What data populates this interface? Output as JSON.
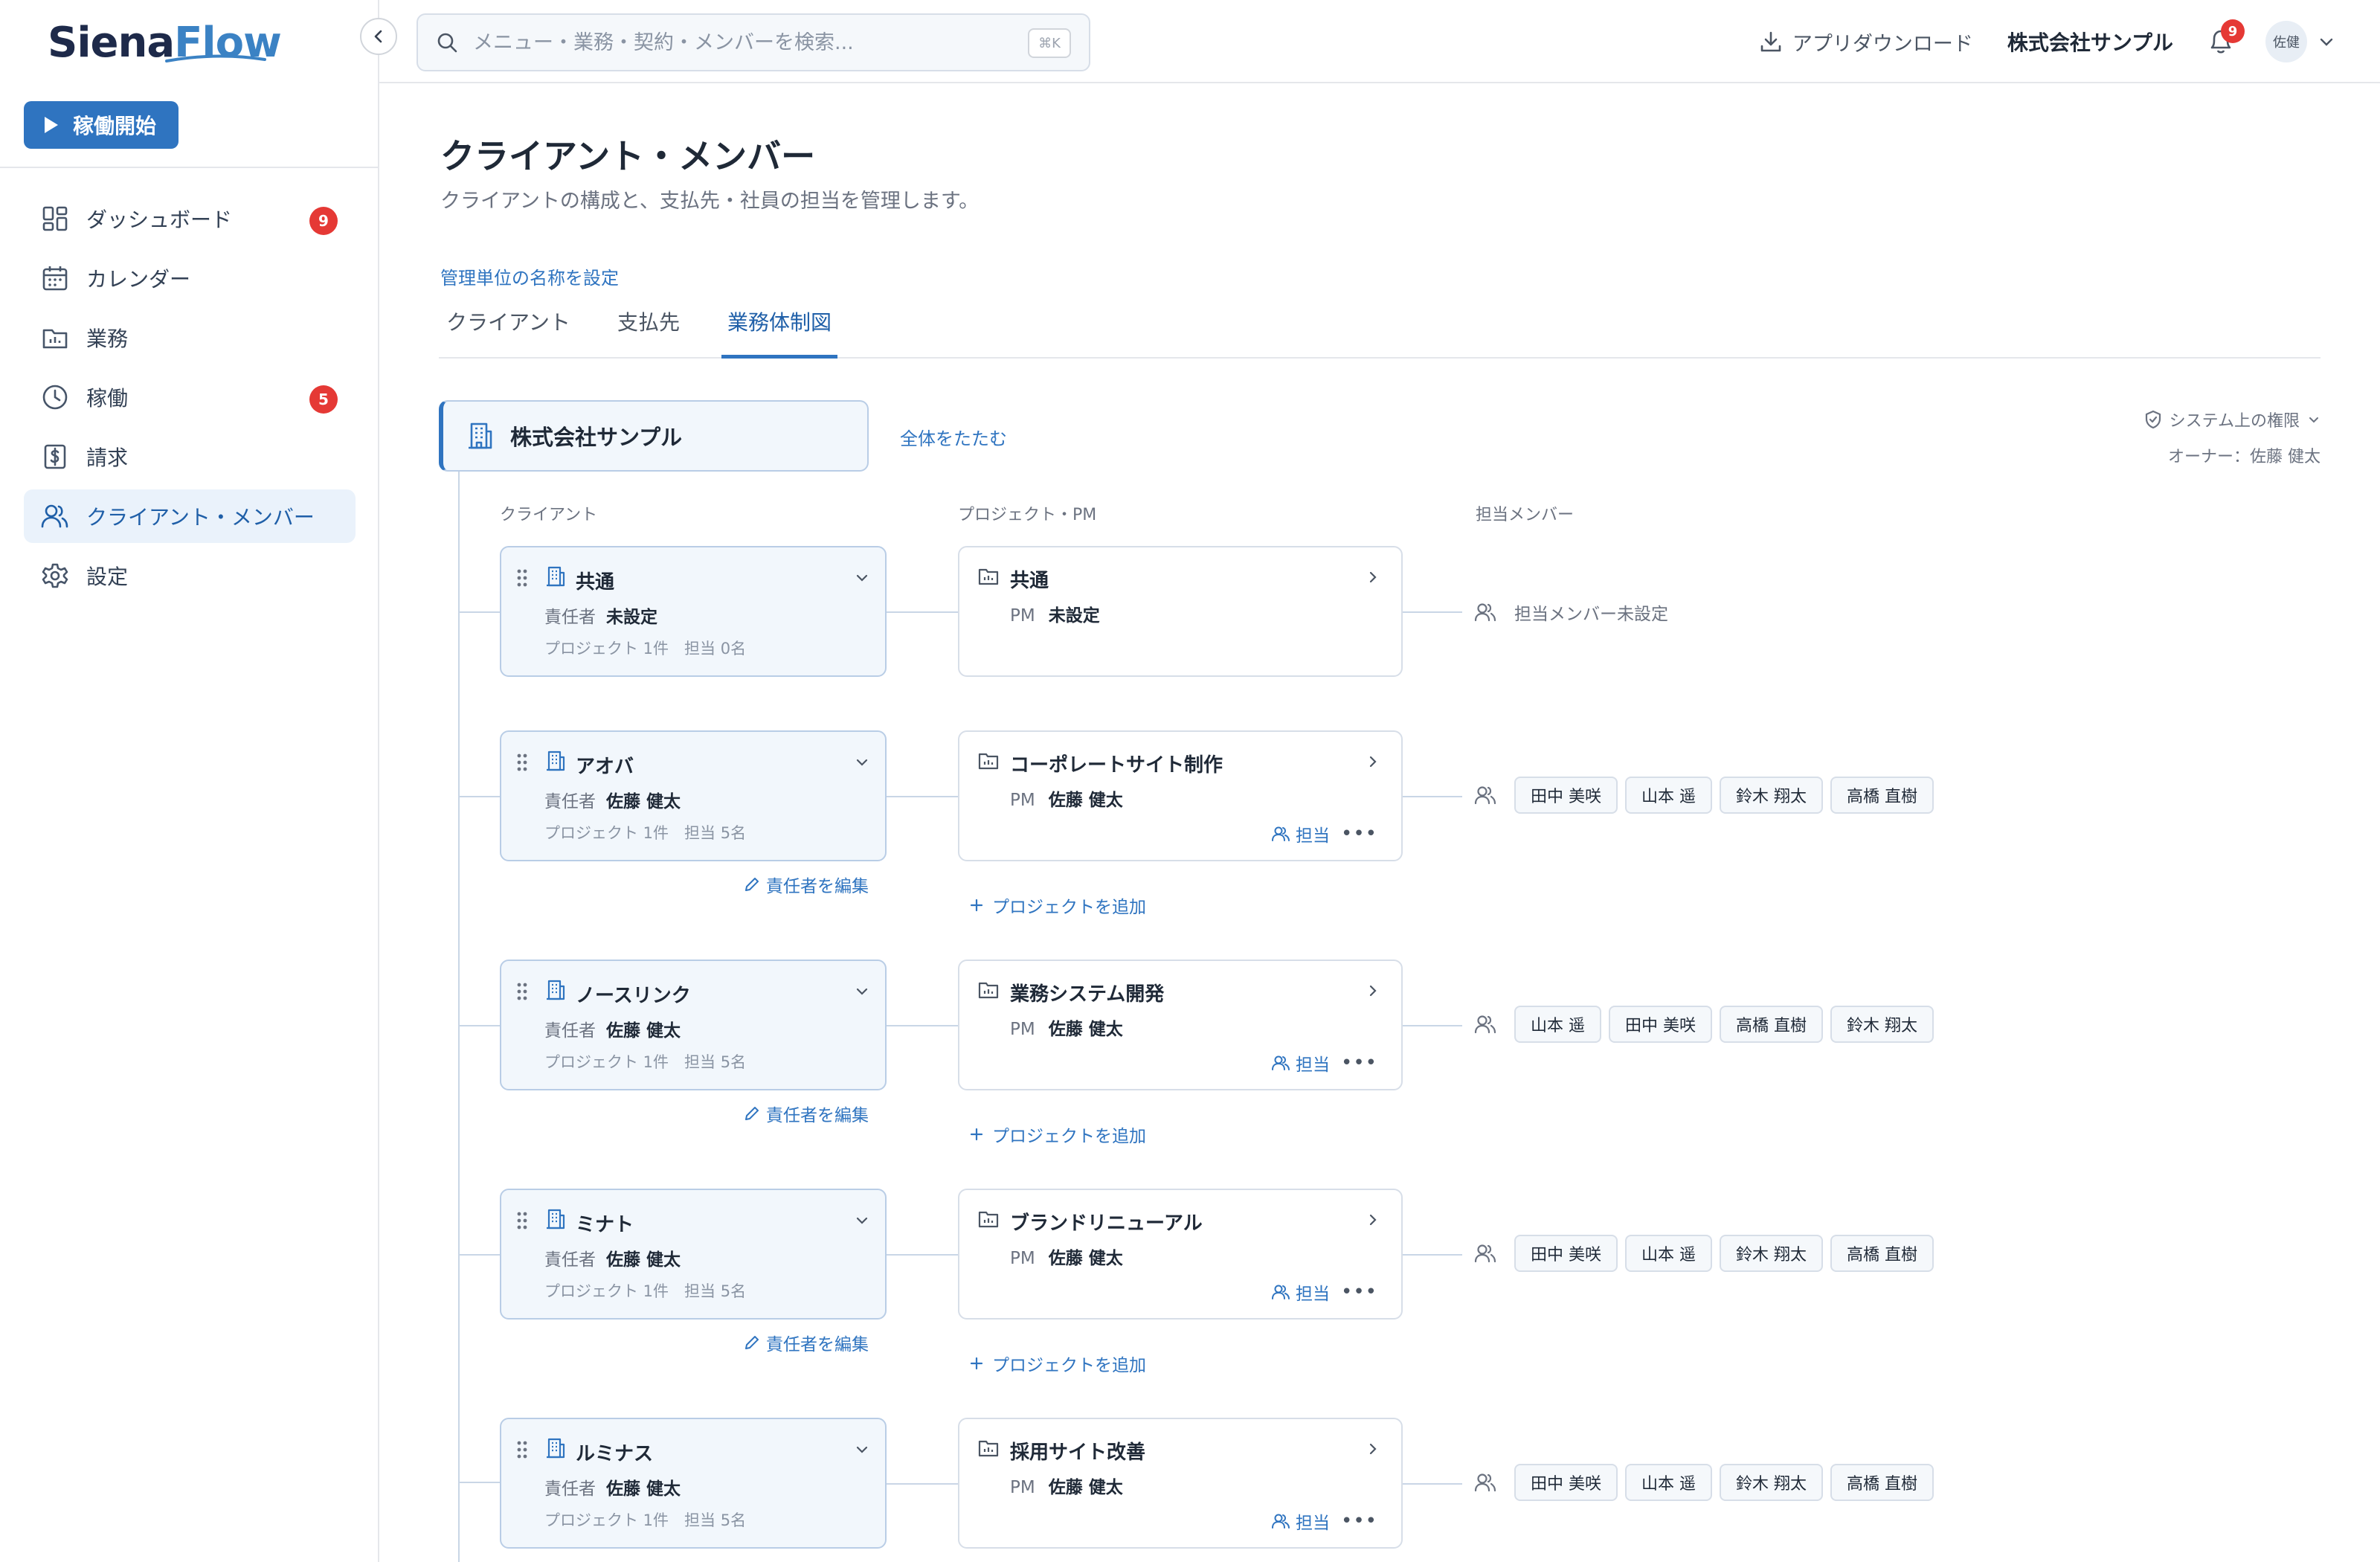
{
  "brand": {
    "logo_part1": "Siena",
    "logo_part2": "Flow"
  },
  "sidebar": {
    "start_button": "稼働開始",
    "items": [
      {
        "label": "ダッシュボード",
        "badge": "9",
        "icon": "dashboard-icon"
      },
      {
        "label": "カレンダー",
        "badge": "",
        "icon": "calendar-icon"
      },
      {
        "label": "業務",
        "badge": "",
        "icon": "folder-icon"
      },
      {
        "label": "稼働",
        "badge": "5",
        "icon": "clock-icon"
      },
      {
        "label": "請求",
        "badge": "",
        "icon": "invoice-icon"
      },
      {
        "label": "クライアント・メンバー",
        "badge": "",
        "icon": "users-icon",
        "active": true
      },
      {
        "label": "設定",
        "badge": "",
        "icon": "gear-icon"
      }
    ]
  },
  "topbar": {
    "search_placeholder": "メニュー・業務・契約・メンバーを検索...",
    "shortcut": "⌘K",
    "app_download": "アプリダウンロード",
    "company": "株式会社サンプル",
    "notification_count": "9",
    "avatar": "佐健"
  },
  "page": {
    "title": "クライアント・メンバー",
    "subtitle": "クライアントの構成と、支払先・社員の担当を管理します。",
    "unit_link": "管理単位の名称を設定",
    "tabs": [
      "クライアント",
      "支払先",
      "業務体制図"
    ],
    "active_tab": 2
  },
  "org": {
    "root_name": "株式会社サンプル",
    "collapse_all": "全体をたたむ",
    "permission": "システム上の権限",
    "owner": "オーナー：佐藤 健太",
    "col_client": "クライアント",
    "col_project": "プロジェクト・PM",
    "col_members": "担当メンバー",
    "resp_label": "責任者",
    "pm_label": "PM",
    "edit_resp": "責任者を編集",
    "add_project": "プロジェクトを追加",
    "assign": "担当",
    "no_member": "担当メンバー未設定",
    "clients": [
      {
        "name": "共通",
        "resp": "未設定",
        "stats": "プロジェクト 1件　担当 0名",
        "project": "共通",
        "pm": "未設定",
        "members": []
      },
      {
        "name": "アオバ",
        "resp": "佐藤 健太",
        "stats": "プロジェクト 1件　担当 5名",
        "project": "コーポレートサイト制作",
        "pm": "佐藤 健太",
        "members": [
          "田中 美咲",
          "山本 遥",
          "鈴木 翔太",
          "高橋 直樹"
        ]
      },
      {
        "name": "ノースリンク",
        "resp": "佐藤 健太",
        "stats": "プロジェクト 1件　担当 5名",
        "project": "業務システム開発",
        "pm": "佐藤 健太",
        "members": [
          "山本 遥",
          "田中 美咲",
          "高橋 直樹",
          "鈴木 翔太"
        ]
      },
      {
        "name": "ミナト",
        "resp": "佐藤 健太",
        "stats": "プロジェクト 1件　担当 5名",
        "project": "ブランドリニューアル",
        "pm": "佐藤 健太",
        "members": [
          "田中 美咲",
          "山本 遥",
          "鈴木 翔太",
          "高橋 直樹"
        ]
      },
      {
        "name": "ルミナス",
        "resp": "佐藤 健太",
        "stats": "プロジェクト 1件　担当 5名",
        "project": "採用サイト改善",
        "pm": "佐藤 健太",
        "members": [
          "田中 美咲",
          "山本 遥",
          "鈴木 翔太",
          "高橋 直樹"
        ]
      }
    ]
  },
  "colors": {
    "accent": "#2f74c0",
    "badge": "#e53935",
    "card_bg": "#f2f7fc"
  }
}
